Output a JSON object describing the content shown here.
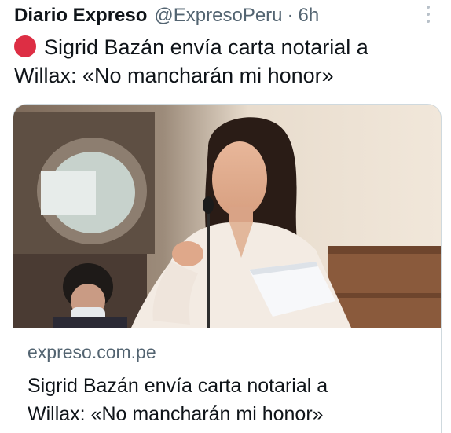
{
  "tweet": {
    "display_name": "Diario Expreso",
    "handle": "@ExpresoPeru",
    "separator": "·",
    "time": "6h",
    "more_icon": "more-vertical-icon",
    "emoji_icon": "red-circle-icon",
    "text_line1": "Sigrid Bazán envía carta notarial a",
    "text_line2": "Willax: «No mancharán mi honor»"
  },
  "card": {
    "domain": "expreso.com.pe",
    "title_line1": "Sigrid Bazán envía carta notarial a",
    "title_line2": "Willax: «No mancharán mi honor»"
  },
  "colors": {
    "text": "#0f1419",
    "secondary": "#536471",
    "border": "#cfd9de",
    "red_circle": "#dd2e44"
  }
}
